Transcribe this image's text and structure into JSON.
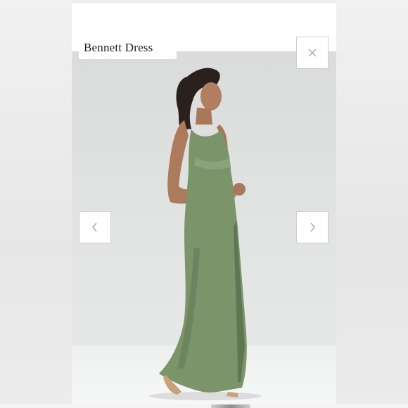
{
  "modal": {
    "title": "Bennett Dress"
  },
  "controls": {
    "close_icon": "close-icon",
    "prev_icon": "chevron-left-icon",
    "next_icon": "chevron-right-icon"
  },
  "colors": {
    "dress": "#7b946a",
    "backdrop": "#dfe1e1",
    "button_border": "#cfcfcf"
  }
}
